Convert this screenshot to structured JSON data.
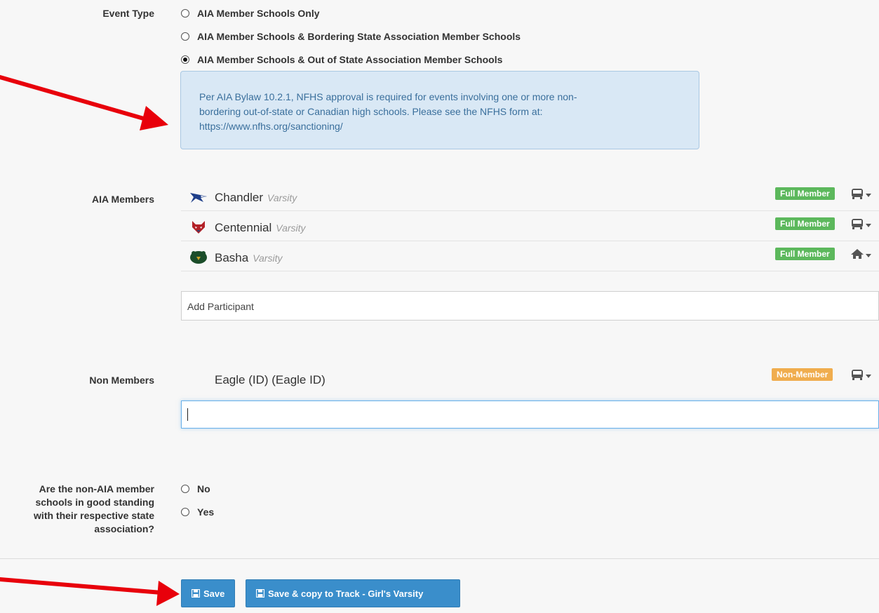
{
  "event_type": {
    "label": "Event Type",
    "options": [
      {
        "label": "AIA Member Schools Only",
        "checked": false
      },
      {
        "label": "AIA Member Schools & Bordering State Association Member Schools",
        "checked": false
      },
      {
        "label": "AIA Member Schools & Out of State Association Member Schools",
        "checked": true
      }
    ],
    "info_lines": [
      "Per AIA Bylaw 10.2.1, NFHS approval is required for events involving one or more non-",
      "bordering out-of-state or Canadian high schools. Please see the NFHS form at:",
      "https://www.nfhs.org/sanctioning/"
    ]
  },
  "aia_members": {
    "label": "AIA Members",
    "items": [
      {
        "name": "Chandler",
        "level": "Varsity",
        "badge": "Full Member",
        "transport_icon": "bus-icon",
        "logo": "chandler-wolf-logo"
      },
      {
        "name": "Centennial",
        "level": "Varsity",
        "badge": "Full Member",
        "transport_icon": "bus-icon",
        "logo": "centennial-coyote-logo"
      },
      {
        "name": "Basha",
        "level": "Varsity",
        "badge": "Full Member",
        "transport_icon": "home-icon",
        "logo": "basha-bear-logo"
      }
    ],
    "add_participant_placeholder": "Add Participant"
  },
  "non_members": {
    "label": "Non Members",
    "items": [
      {
        "name": "Eagle (ID) (Eagle ID)",
        "badge": "Non-Member",
        "transport_icon": "bus-icon"
      }
    ],
    "input_value": ""
  },
  "good_standing": {
    "label_lines": [
      "Are the non-AIA member",
      "schools in good standing",
      "with their respective state",
      "association?"
    ],
    "options": [
      {
        "label": "No",
        "checked": false
      },
      {
        "label": "Yes",
        "checked": false
      }
    ]
  },
  "buttons": {
    "save": "Save",
    "save_copy": "Save & copy to Track - Girl's Varsity"
  },
  "colors": {
    "accent": "#3a8ecb",
    "full_member": "#5cb85c",
    "non_member": "#f0ad4e",
    "info_bg": "#d9e8f5",
    "annotation_arrow": "#e8000b"
  }
}
